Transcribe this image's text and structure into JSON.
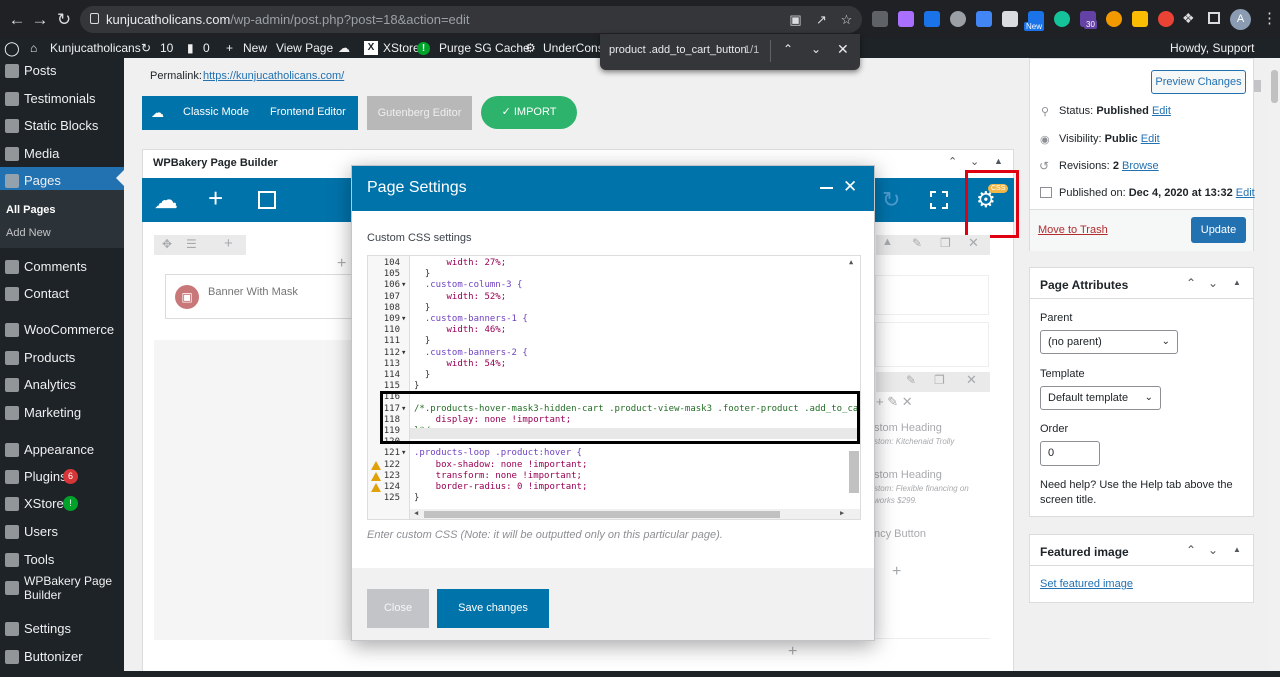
{
  "browser": {
    "url_host": "kunjucatholicans.com",
    "url_path": "/wp-admin/post.php?post=18&action=edit",
    "profile_initial": "A",
    "ext_new_label": "New",
    "ext_count": "30"
  },
  "find_bar": {
    "query": "product .add_to_cart_button",
    "count": "1/1"
  },
  "admin_bar": {
    "site_name": "Kunjucatholicans",
    "updates_count": "10",
    "comments_count": "0",
    "new_label": "New",
    "view_page": "View Page",
    "xstore_label": "XStore",
    "xstore_badge": "!",
    "purge_cache": "Purge SG Cache",
    "under_construction": "UnderConst",
    "howdy": "Howdy, Support"
  },
  "sidebar": {
    "items": [
      {
        "label": "Posts"
      },
      {
        "label": "Testimonials"
      },
      {
        "label": "Static Blocks"
      },
      {
        "label": "Media"
      },
      {
        "label": "Pages"
      },
      {
        "label": "Comments"
      },
      {
        "label": "Contact"
      },
      {
        "label": "WooCommerce"
      },
      {
        "label": "Products"
      },
      {
        "label": "Analytics"
      },
      {
        "label": "Marketing"
      },
      {
        "label": "Appearance"
      },
      {
        "label": "Plugins",
        "badge": "6"
      },
      {
        "label": "XStore",
        "badge": "!"
      },
      {
        "label": "Users"
      },
      {
        "label": "Tools"
      },
      {
        "label": "WPBakery Page Builder"
      },
      {
        "label": "Settings"
      },
      {
        "label": "Buttonizer"
      }
    ],
    "submenu": {
      "all_pages": "All Pages",
      "add_new": "Add New"
    }
  },
  "editor": {
    "permalink_label": "Permalink:",
    "permalink_url": "https://kunjucatholicans.com/",
    "classic_mode": "Classic Mode",
    "frontend_editor": "Frontend Editor",
    "gutenberg_editor": "Gutenberg Editor",
    "import_label": "IMPORT",
    "wpb_title": "WPBakery Page Builder",
    "css_badge": "CSS",
    "element_banner": "Banner With Mask",
    "bg_custom_heading_1": "stom Heading",
    "bg_custom_heading_1_sub": "stom: Kitchenaid Trolly",
    "bg_custom_heading_2": "stom Heading",
    "bg_custom_heading_2_sub": "stom: Flexible financing on",
    "bg_custom_heading_2_sub2": "works $299.",
    "bg_fancy_button": "ncy Button"
  },
  "modal": {
    "title": "Page Settings",
    "section_label": "Custom CSS settings",
    "hint": "Enter custom CSS (Note: it will be outputted only on this particular page).",
    "close_label": "Close",
    "save_label": "Save changes",
    "code_lines": [
      {
        "n": "104",
        "fold": "",
        "warn": false,
        "text": "      width: 27%;"
      },
      {
        "n": "105",
        "fold": "",
        "warn": false,
        "text": "  }"
      },
      {
        "n": "106",
        "fold": "▾",
        "warn": false,
        "text": "  .custom-column-3 {"
      },
      {
        "n": "107",
        "fold": "",
        "warn": false,
        "text": "      width: 52%;"
      },
      {
        "n": "108",
        "fold": "",
        "warn": false,
        "text": "  }"
      },
      {
        "n": "109",
        "fold": "▾",
        "warn": false,
        "text": "  .custom-banners-1 {"
      },
      {
        "n": "110",
        "fold": "",
        "warn": false,
        "text": "      width: 46%;"
      },
      {
        "n": "111",
        "fold": "",
        "warn": false,
        "text": "  }"
      },
      {
        "n": "112",
        "fold": "▾",
        "warn": false,
        "text": "  .custom-banners-2 {"
      },
      {
        "n": "113",
        "fold": "",
        "warn": false,
        "text": "      width: 54%;"
      },
      {
        "n": "114",
        "fold": "",
        "warn": false,
        "text": "  }"
      },
      {
        "n": "115",
        "fold": "",
        "warn": false,
        "text": "}"
      },
      {
        "n": "116",
        "fold": "",
        "warn": false,
        "text": ""
      },
      {
        "n": "117",
        "fold": "▾",
        "warn": false,
        "text": "/*.products-hover-mask3-hidden-cart .product-view-mask3 .footer-product .add_to_ca"
      },
      {
        "n": "118",
        "fold": "",
        "warn": false,
        "text": "    display: none !important;"
      },
      {
        "n": "119",
        "fold": "",
        "warn": false,
        "text": "}*/"
      },
      {
        "n": "120",
        "fold": "",
        "warn": false,
        "text": ""
      },
      {
        "n": "121",
        "fold": "▾",
        "warn": false,
        "text": ".products-loop .product:hover {"
      },
      {
        "n": "122",
        "fold": "",
        "warn": true,
        "text": "    box-shadow: none !important;"
      },
      {
        "n": "123",
        "fold": "",
        "warn": true,
        "text": "    transform: none !important;"
      },
      {
        "n": "124",
        "fold": "",
        "warn": true,
        "text": "    border-radius: 0 !important;"
      },
      {
        "n": "125",
        "fold": "",
        "warn": false,
        "text": "}"
      }
    ]
  },
  "publish_box": {
    "preview_changes": "Preview Changes",
    "status_label": "Status:",
    "status_value": "Published",
    "edit": "Edit",
    "visibility_label": "Visibility:",
    "visibility_value": "Public",
    "revisions_label": "Revisions:",
    "revisions_value": "2",
    "browse": "Browse",
    "published_on_label": "Published on:",
    "published_on_value": "Dec 4, 2020 at 13:32",
    "move_to_trash": "Move to Trash",
    "update": "Update"
  },
  "page_attributes": {
    "title": "Page Attributes",
    "parent_label": "Parent",
    "parent_value": "(no parent)",
    "template_label": "Template",
    "template_value": "Default template",
    "order_label": "Order",
    "order_value": "0",
    "help": "Need help? Use the Help tab above the screen title."
  },
  "featured_image": {
    "title": "Featured image",
    "set_link": "Set featured image"
  },
  "colors": {
    "wp_blue": "#0073aa",
    "admin_dark": "#1d2327",
    "import_green": "#2db36b",
    "red_outline": "#e00012",
    "css_badge": "#f0b849"
  }
}
